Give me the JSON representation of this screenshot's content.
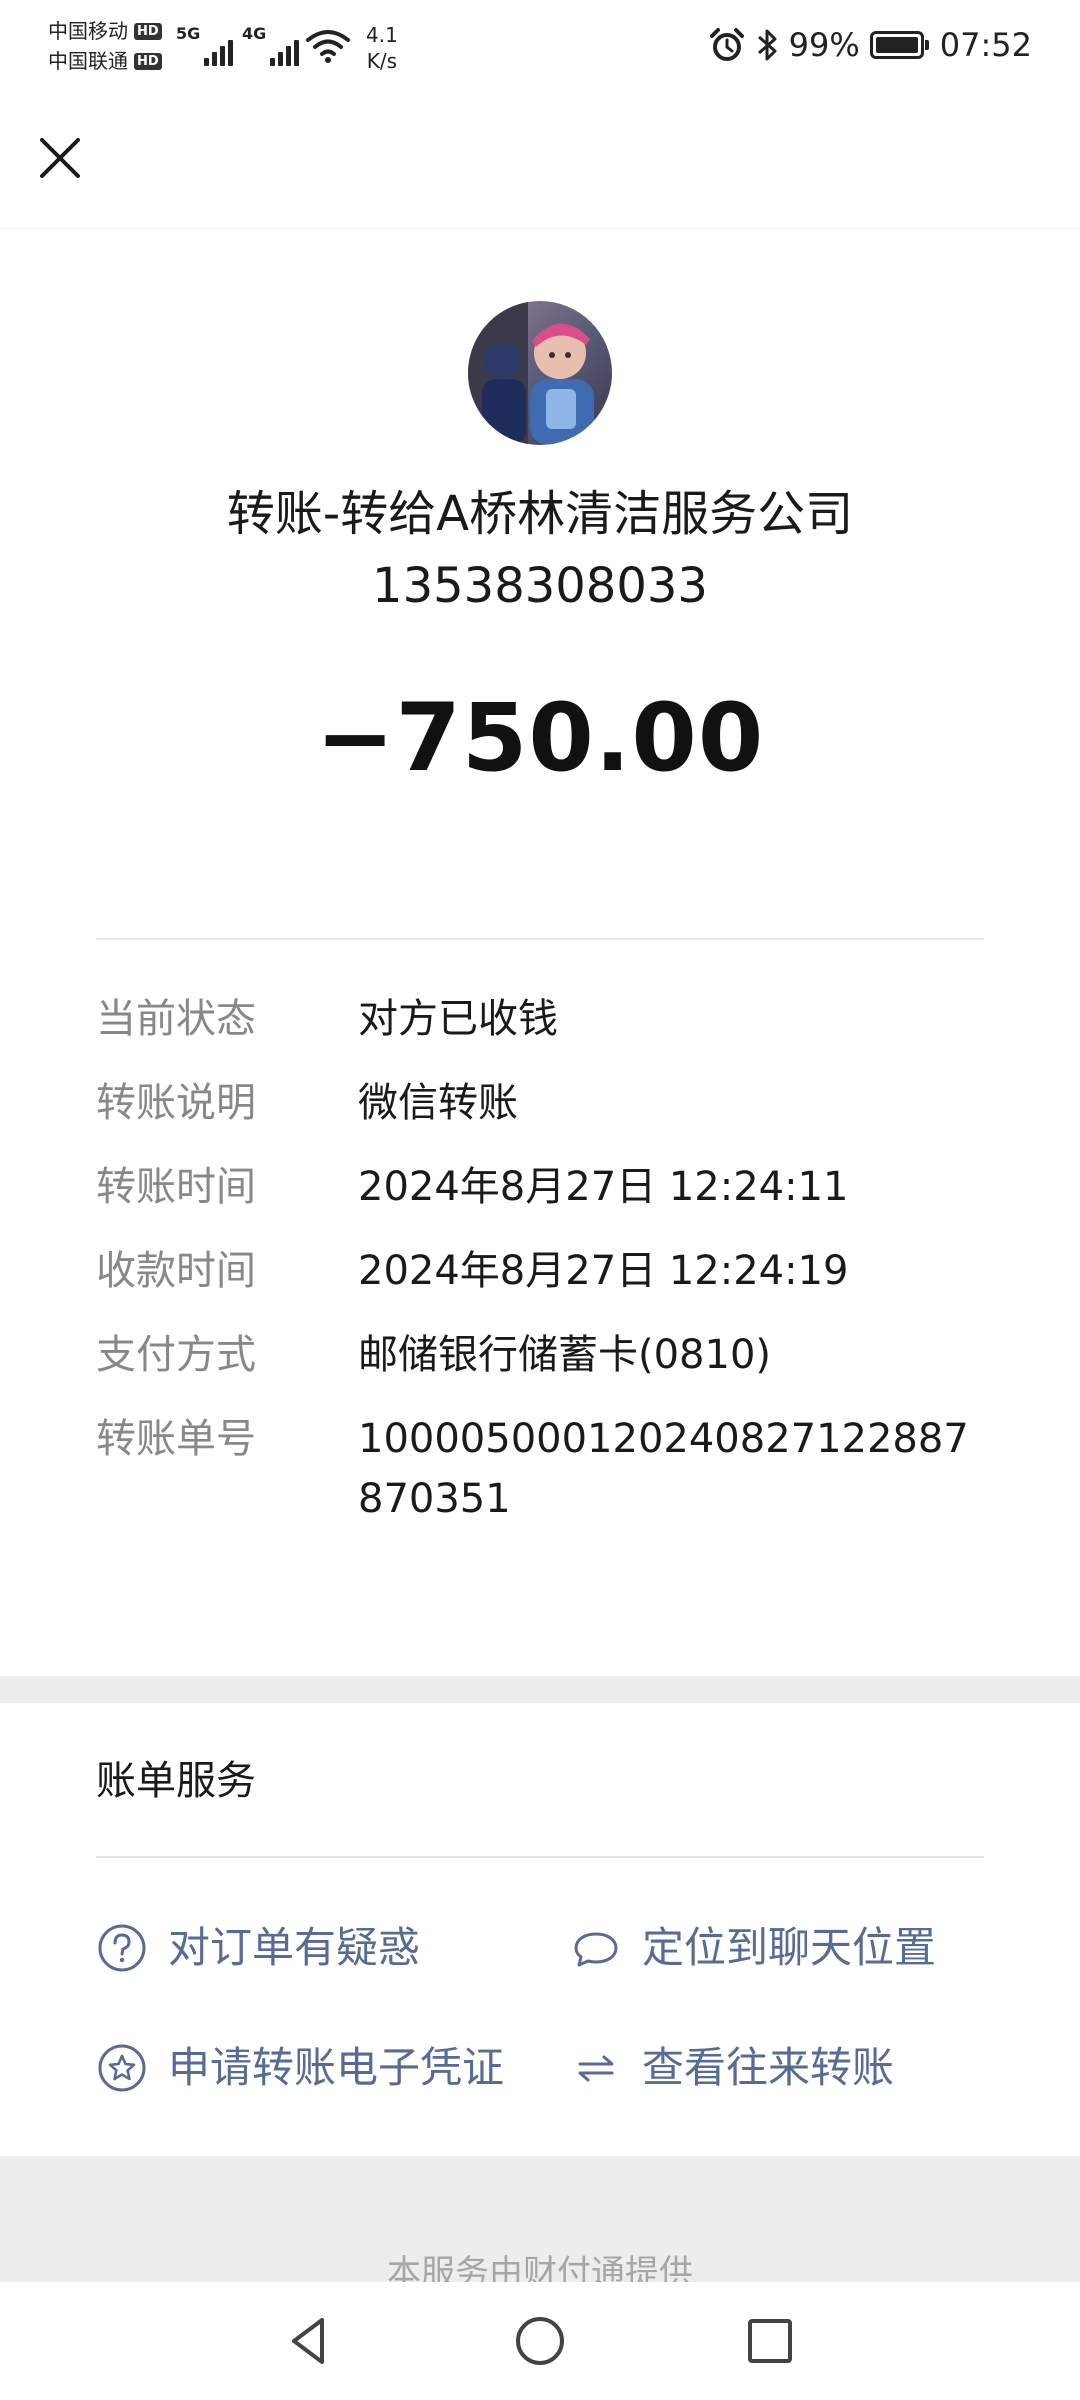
{
  "status_bar": {
    "carrier_1": "中国移动",
    "carrier_2": "中国联通",
    "hd_badge": "HD",
    "net_1": "5G",
    "net_2": "4G",
    "net_speed_value": "4.1",
    "net_speed_unit": "K/s",
    "battery_percent": "99%",
    "battery_level": 0.99,
    "time": "07:52",
    "icons": [
      "alarm-icon",
      "bluetooth-icon",
      "battery-icon",
      "wifi-icon",
      "signal-icon"
    ]
  },
  "header": {
    "close_icon": "close-icon"
  },
  "transfer": {
    "title": "转账-转给A桥林清洁服务公司",
    "phone": "13538308033",
    "amount": "−750.00"
  },
  "details": [
    {
      "label": "当前状态",
      "value": "对方已收钱"
    },
    {
      "label": "转账说明",
      "value": "微信转账"
    },
    {
      "label": "转账时间",
      "value": "2024年8月27日 12:24:11"
    },
    {
      "label": "收款时间",
      "value": "2024年8月27日 12:24:19"
    },
    {
      "label": "支付方式",
      "value": "邮储银行储蓄卡(0810)"
    },
    {
      "label": "转账单号",
      "value": "100005000120240827122887870351"
    }
  ],
  "services": {
    "title": "账单服务",
    "items": [
      {
        "label": "对订单有疑惑",
        "icon": "question-circle-icon"
      },
      {
        "label": "定位到聊天位置",
        "icon": "chat-bubble-icon"
      },
      {
        "label": "申请转账电子凭证",
        "icon": "star-circle-icon"
      },
      {
        "label": "查看往来转账",
        "icon": "swap-arrows-icon"
      }
    ]
  },
  "footer": {
    "note": "本服务由财付通提供"
  },
  "theme": {
    "link_color": "#576b95",
    "label_color": "#888888",
    "background": "#ededed"
  }
}
